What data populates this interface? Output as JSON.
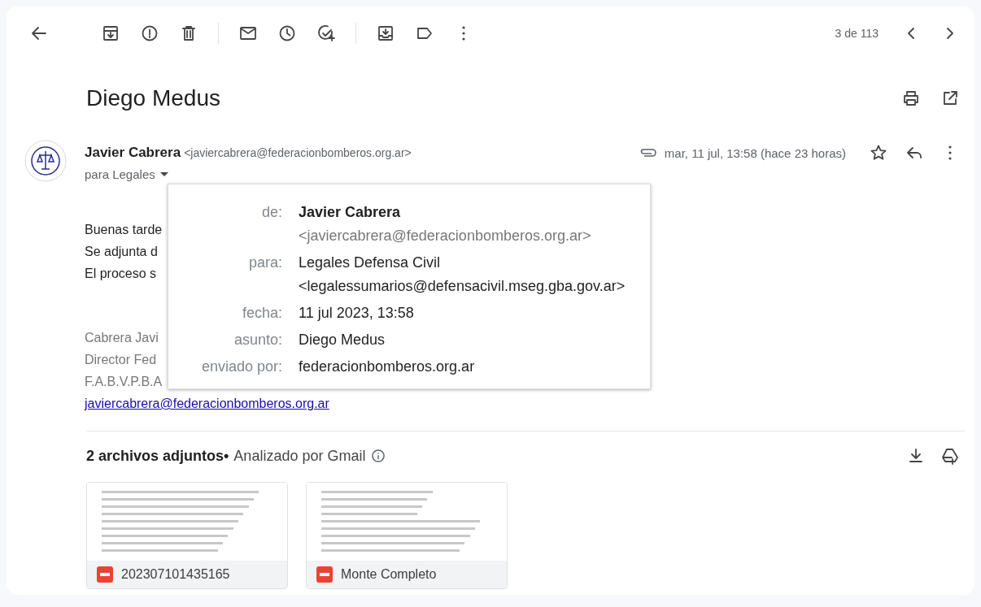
{
  "toolbar": {
    "counter": "3 de 113"
  },
  "subject": "Diego Medus",
  "message": {
    "sender_name": "Javier Cabrera",
    "sender_email": "<javiercabrera@federacionbomberos.org.ar>",
    "recipient": "para Legales",
    "date": "mar, 11 jul, 13:58 (hace 23 horas)",
    "starred": false,
    "body": [
      "Buenas tarde",
      "Se adjunta d",
      "El proceso s"
    ],
    "signature": [
      "Cabrera Javi",
      "Director Fed",
      "F.A.B.V.P.B.A"
    ],
    "signature_link": "javiercabrera@federacionbomberos.org.ar"
  },
  "details_popup": {
    "rows": [
      {
        "kind": "contact",
        "label": "de:",
        "name": "Javier Cabrera",
        "address": "<javiercabrera@federacionbomberos.org.ar>"
      },
      {
        "kind": "plain_contact",
        "label": "para:",
        "name": "Legales Defensa Civil",
        "address": "<legalessumarios@defensacivil.mseg.gba.gov.ar>"
      },
      {
        "kind": "text",
        "label": "fecha:",
        "value": "11 jul 2023, 13:58"
      },
      {
        "kind": "text",
        "label": "asunto:",
        "value": "Diego Medus"
      },
      {
        "kind": "text",
        "label": "enviado por:",
        "value": "federacionbomberos.org.ar"
      }
    ]
  },
  "attachments": {
    "title": "2 archivos adjuntos•",
    "scan_note": "Analizado por Gmail",
    "files": [
      {
        "name": "202307101435165"
      },
      {
        "name": "Monte Completo"
      }
    ]
  }
}
